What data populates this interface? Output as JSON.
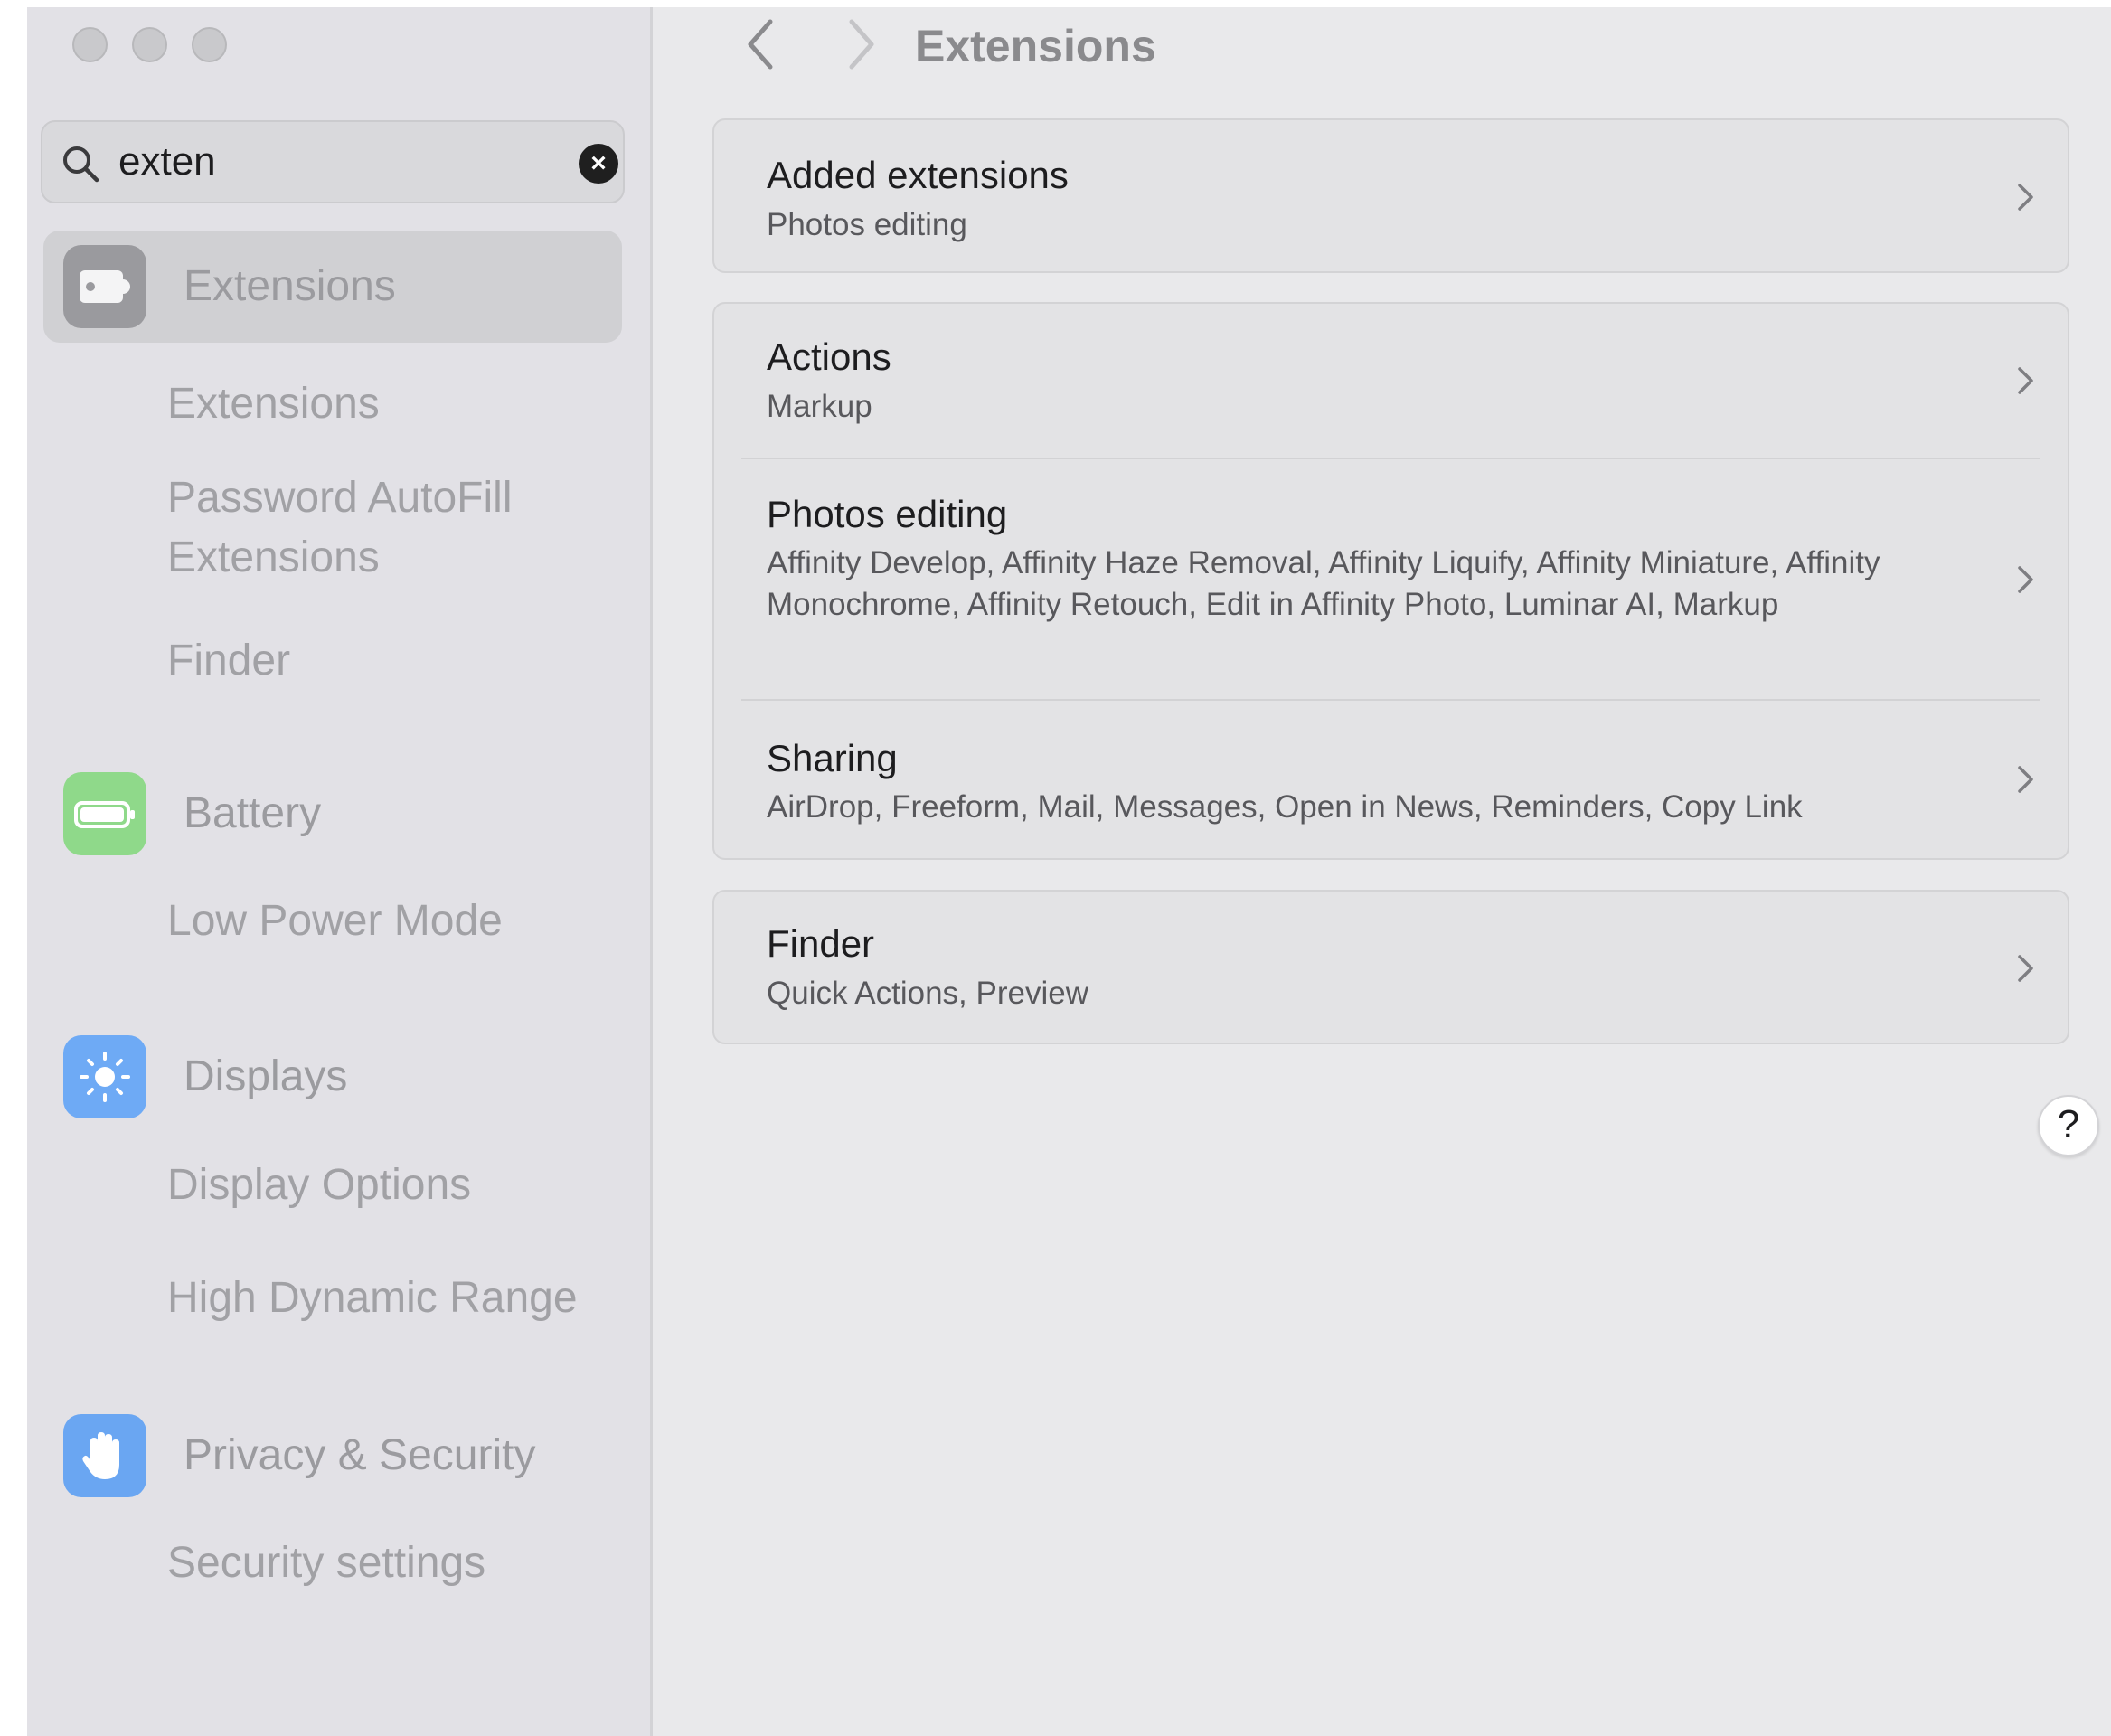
{
  "window": {
    "traffic_lights": [
      "close",
      "minimize",
      "zoom"
    ]
  },
  "search": {
    "value": "exten",
    "icon": "search-icon",
    "clear_icon": "clear-icon"
  },
  "sidebar": {
    "groups": [
      {
        "label": "Extensions",
        "icon": "puzzle-piece-icon",
        "icon_color": "#9a9a9e",
        "selected": true,
        "subitems": [
          "Extensions",
          "Password AutoFill Extensions",
          "Finder"
        ]
      },
      {
        "label": "Battery",
        "icon": "battery-icon",
        "icon_color": "#8fd98a",
        "selected": false,
        "subitems": [
          "Low Power Mode"
        ]
      },
      {
        "label": "Displays",
        "icon": "sun-icon",
        "icon_color": "#6eaaf5",
        "selected": false,
        "subitems": [
          "Display Options",
          "High Dynamic Range"
        ]
      },
      {
        "label": "Privacy & Security",
        "icon": "hand-icon",
        "icon_color": "#6aa6f2",
        "selected": false,
        "subitems": [
          "Security settings"
        ]
      }
    ]
  },
  "main": {
    "title": "Extensions",
    "back_icon": "chevron-left-icon",
    "forward_icon": "chevron-right-icon",
    "sections": [
      {
        "rows": [
          {
            "title": "Added extensions",
            "subtitle": "Photos editing"
          }
        ]
      },
      {
        "rows": [
          {
            "title": "Actions",
            "subtitle": "Markup"
          },
          {
            "title": "Photos editing",
            "subtitle": "Affinity Develop, Affinity Haze Removal, Affinity Liquify, Affinity Miniature, Affinity Monochrome, Affinity Retouch, Edit in Affinity Photo, Luminar AI, Markup"
          },
          {
            "title": "Sharing",
            "subtitle": "AirDrop, Freeform, Mail, Messages, Open in News, Reminders, Copy Link"
          }
        ]
      },
      {
        "rows": [
          {
            "title": "Finder",
            "subtitle": "Quick Actions, Preview"
          }
        ]
      }
    ],
    "help_label": "?"
  }
}
